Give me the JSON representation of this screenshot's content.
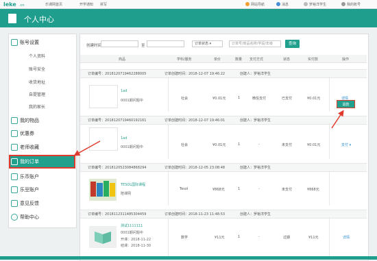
{
  "topbar": {
    "links": [
      "乐课网首页",
      "开学通知",
      "拼写"
    ],
    "right_links": [
      "网站导航",
      "消息",
      "罗裕洋学生",
      "我的账号"
    ]
  },
  "header": {
    "title": "个人中心"
  },
  "sidebar": {
    "account_settings": "账号设置",
    "account_items": [
      "个人资料",
      "账号安全",
      "收货地址",
      "自提管理",
      "我的家长"
    ],
    "items": [
      "我的物品",
      "优惠券",
      "老师收藏",
      "我的订单",
      "乐币账户",
      "乐豆账户",
      "意见反馈",
      "帮助中心"
    ]
  },
  "filter": {
    "date_label": "创建时间",
    "date_to": "至",
    "status_value": "订单状态",
    "search_placeholder": "订单号/商品名称/学段/年级",
    "search_button": "查询"
  },
  "columns": [
    "商品",
    "学科/服务",
    "单价",
    "数量",
    "支付方式",
    "状态",
    "实付款",
    "操作"
  ],
  "orders": [
    {
      "order_no": "订单编号：2018120719462288005",
      "created": "订单创建时间：2018-12-07 19:46:22",
      "creator": "创建人：罗裕洋学生",
      "product": "1ad",
      "product_sub": "0001期问题中",
      "subject": "社会",
      "price": "¥0.01元",
      "qty": "1",
      "pay": "微信支付",
      "status": "已支付",
      "paid": "¥0.01元",
      "action": "详情",
      "action2": "退款"
    },
    {
      "order_no": "订单编号：2018120719460192161",
      "created": "订单创建时间：2018-12-07 19:46:01",
      "creator": "创建人：罗裕洋学生",
      "product": "1ad",
      "product_sub": "0001期问题中",
      "subject": "社会",
      "price": "¥0.01元",
      "qty": "1",
      "pay": "-",
      "status": "未支付",
      "paid": "¥0.01元",
      "action": "支付 ▾"
    },
    {
      "order_no": "订单编号：2018120523084868294",
      "created": "订单创建时间：2018-12-05 23:08:48",
      "creator": "创建人：罗裕洋学生",
      "product": "TESOL国际课程",
      "product_sub": "陪课网",
      "subject": "Tesol",
      "price": "¥868元",
      "qty": "1",
      "pay": "-",
      "status": "未支付",
      "paid": "¥868元",
      "action": ""
    },
    {
      "order_no": "订单编号：2018112311485304459",
      "created": "订单创建时间：2018-11-23 11:48:53",
      "creator": "创建人：罗裕洋学生",
      "product": "测试1111111",
      "product_sub": "0001期问题中",
      "date_start": "开课：2018-11-22",
      "date_end": "结课：2018-11-30",
      "subject": "数学",
      "price": "¥11元",
      "qty": "1",
      "pay": "-",
      "status": "过期",
      "paid": "¥11元",
      "action": "详情"
    }
  ],
  "colors": {
    "brand": "#1f9e8e",
    "highlight": "#e03a2e",
    "link": "#2a8fd0"
  }
}
